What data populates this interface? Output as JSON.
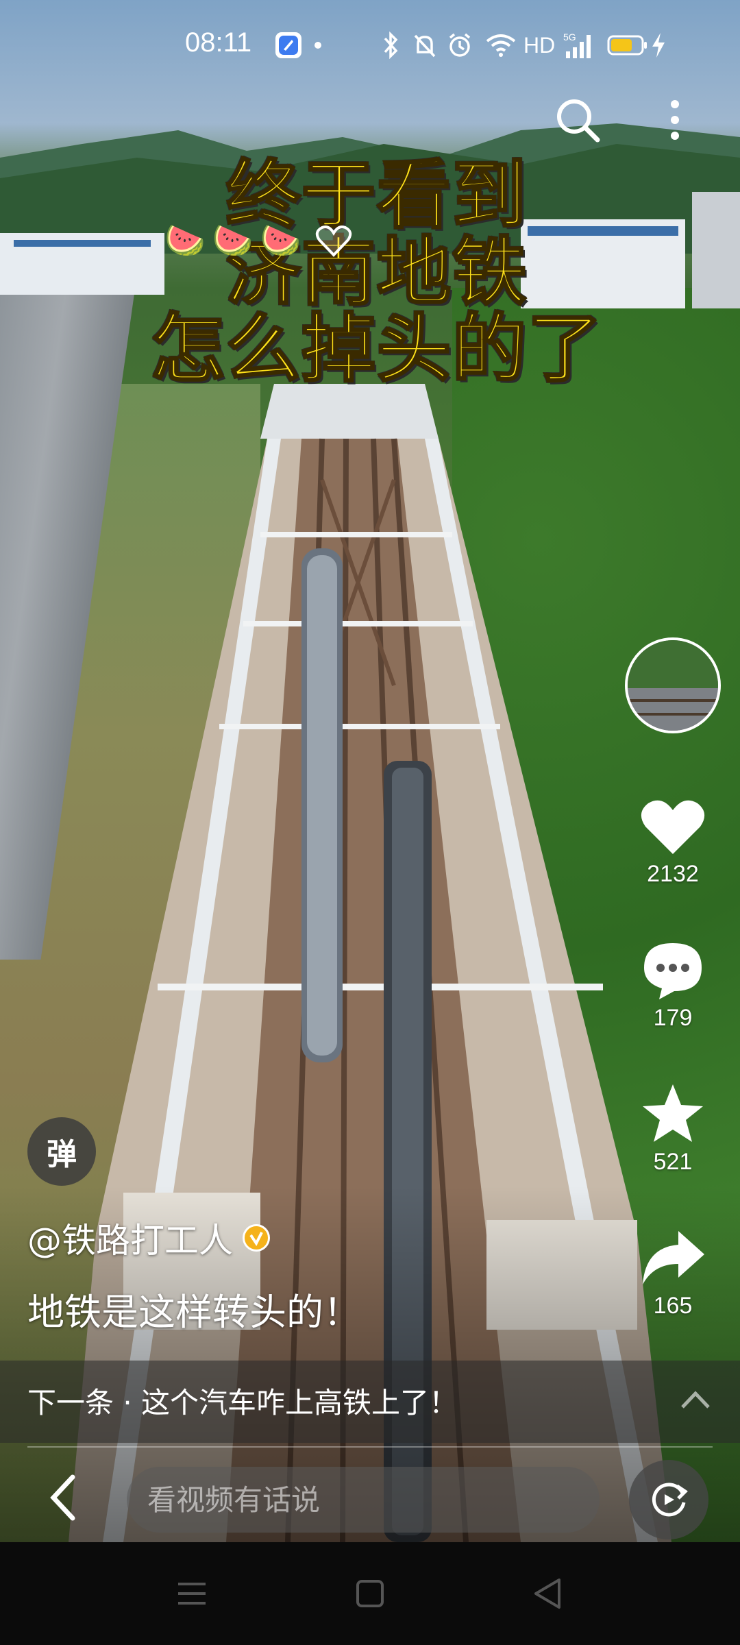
{
  "status_bar": {
    "time": "08:11",
    "network_label": "HD",
    "signal_label": "5G",
    "icons": [
      "app-icon",
      "dot-icon",
      "bluetooth-icon",
      "mute-icon",
      "alarm-icon",
      "wifi-icon",
      "hd-icon",
      "signal-5g-icon",
      "battery-icon",
      "charging-icon"
    ],
    "battery_color": "#f5c518"
  },
  "video": {
    "title_lines": [
      "终于看到",
      "济南地铁",
      "怎么掉头的了"
    ],
    "emoji": [
      "🍉",
      "🍉",
      "🍉"
    ]
  },
  "top_actions": {
    "icons": [
      "search-icon",
      "more-vertical-icon"
    ]
  },
  "rail": {
    "like_count": "2132",
    "comment_count": "179",
    "favorite_count": "521",
    "share_count": "165"
  },
  "danmaku": {
    "label": "弹"
  },
  "post": {
    "author": "@铁路打工人",
    "description": "地铁是这样转头的！"
  },
  "next_bar": {
    "text": "下一条 · 这个汽车咋上高铁上了！"
  },
  "input_bar": {
    "placeholder": "看视频有话说"
  },
  "colors": {
    "title_yellow": "#ffe21a",
    "verified_badge": "#f5b21b"
  }
}
